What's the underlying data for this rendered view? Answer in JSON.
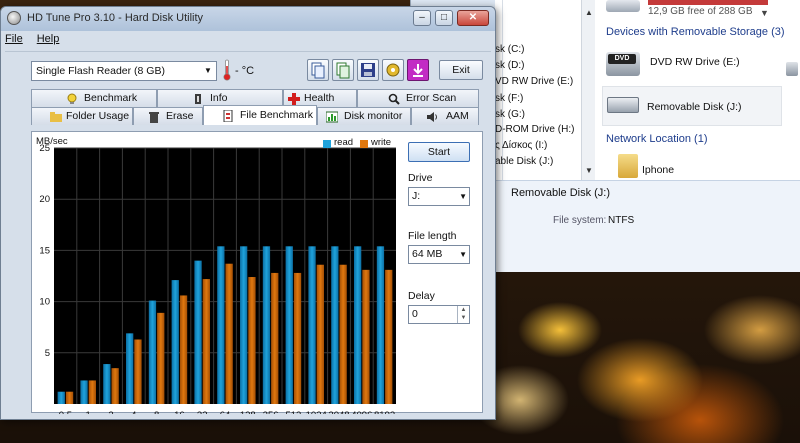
{
  "explorer": {
    "free_space": "12,9 GB free of 288 GB",
    "nav_drives": [
      "sk (C:)",
      "sk (D:)",
      "VD RW Drive (E:)",
      "sk (F:)",
      "sk (G:)",
      "D-ROM Drive (H:)",
      "ς Δίσκος (I:)",
      "able Disk (J:)"
    ],
    "section_removable": "Devices with Removable Storage (3)",
    "dvd_label": "DVD RW Drive (E:)",
    "removable_label": "Removable Disk (J:)",
    "section_network": "Network Location (1)",
    "network_item": "Iphone",
    "details": {
      "title": "Removable Disk (J:)",
      "fs_key": "File system:",
      "fs_value": "NTFS"
    }
  },
  "hdtune": {
    "title": "HD Tune Pro 3.10 - Hard Disk Utility",
    "menu": [
      "File",
      "Help"
    ],
    "drive": "Single  Flash Reader (8 GB)",
    "temperature": "- °C",
    "exit": "Exit",
    "tabs_top": [
      "Benchmark",
      "Info",
      "Health",
      "Error Scan"
    ],
    "tabs_bottom": [
      "Folder Usage",
      "Erase",
      "File Benchmark",
      "Disk monitor",
      "AAM"
    ],
    "side": {
      "start": "Start",
      "drive_label": "Drive",
      "drive_value": "J:",
      "file_length_label": "File length",
      "file_length_value": "64 MB",
      "delay_label": "Delay",
      "delay_value": "0"
    }
  },
  "chart_data": {
    "type": "bar",
    "ylabel": "MB/sec",
    "ylim": [
      0,
      25
    ],
    "yticks": [
      "25",
      "20",
      "15",
      "10",
      "5"
    ],
    "categories": [
      "0.5",
      "1",
      "2",
      "4",
      "8",
      "16",
      "32",
      "64",
      "128",
      "256",
      "512",
      "1024",
      "2048",
      "4096",
      "8192"
    ],
    "series": [
      {
        "name": "read",
        "color": "#1fa3dc",
        "values": [
          1.2,
          2.3,
          3.9,
          6.9,
          10.1,
          12.1,
          14.0,
          15.4,
          15.4,
          15.4,
          15.4,
          15.4,
          15.4,
          15.4,
          15.4
        ]
      },
      {
        "name": "write",
        "color": "#e0780f",
        "values": [
          1.2,
          2.3,
          3.5,
          6.3,
          8.9,
          10.6,
          12.2,
          13.7,
          12.4,
          12.8,
          12.8,
          13.6,
          13.6,
          13.1,
          13.1
        ]
      }
    ],
    "grid": true,
    "legend": "top-right"
  }
}
